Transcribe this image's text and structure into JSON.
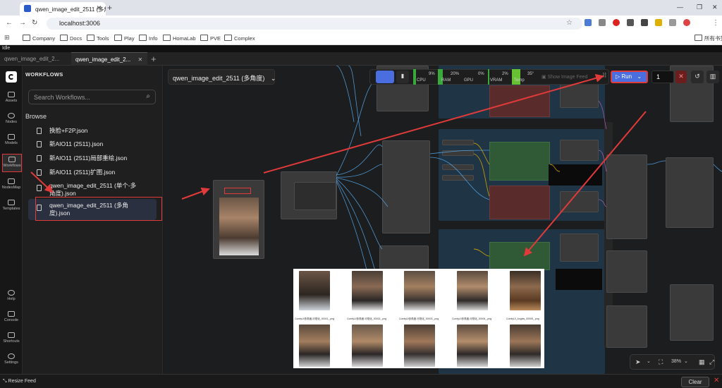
{
  "browser": {
    "tab_title": "qwen_image_edit_2511 (多角",
    "url": "localhost:3006",
    "bookmarks": [
      "Company",
      "Docs",
      "Tools",
      "Play",
      "Info",
      "HomaLab",
      "PVE",
      "Complex"
    ],
    "bookmarks_right": "所有书签"
  },
  "app": {
    "status": "Idle",
    "tabs": [
      {
        "label": "qwen_image_edit_2...",
        "active": false
      },
      {
        "label": "qwen_image_edit_2...",
        "active": true
      }
    ],
    "new_tab_icon": "plus-icon"
  },
  "rail": {
    "top": [
      {
        "label": "Assets",
        "icon": "image-icon"
      },
      {
        "label": "Nodes",
        "icon": "nodes-icon"
      },
      {
        "label": "Models",
        "icon": "cube-icon"
      },
      {
        "label": "Workflows",
        "icon": "workflow-icon",
        "active": true
      },
      {
        "label": "NodesMap",
        "icon": "map-icon"
      },
      {
        "label": "Templates",
        "icon": "template-icon"
      }
    ],
    "bottom": [
      {
        "label": "Help",
        "icon": "help-icon"
      },
      {
        "label": "Console",
        "icon": "console-icon"
      },
      {
        "label": "Shortcuts",
        "icon": "keyboard-icon"
      },
      {
        "label": "Settings",
        "icon": "gear-icon"
      }
    ]
  },
  "sidebar": {
    "title": "WORKFLOWS",
    "search_placeholder": "Search Workflows...",
    "browse_label": "Browse",
    "files": [
      "换脸+F2P.json",
      "新AIO11 (2511).json",
      "新AIO11 (2511)局部重绘.json",
      "新AIO11 (2511)扩图.json",
      "qwen_image_edit_2511 (单个-多角度).json",
      "qwen_image_edit_2511 (多角度).json"
    ],
    "selected_index": 5
  },
  "canvas": {
    "workflow_title": "qwen_image_edit_2511 (多角度)",
    "zoom": "38%"
  },
  "toolbar": {
    "monitors": [
      {
        "label": "CPU",
        "value": "9%",
        "color": "#3aa83a"
      },
      {
        "label": "RAM",
        "value": "20%",
        "color": "#3aa83a"
      },
      {
        "label": "GPU",
        "value": "0%",
        "color": "#3aa83a"
      },
      {
        "label": "VRAM",
        "value": "2%",
        "color": "#3aa83a"
      },
      {
        "label": "Temp",
        "value": "35°",
        "color": "#66c233"
      }
    ],
    "show_image_feed": "Show Image Feed",
    "run_label": "Run",
    "queue_count": "1"
  },
  "preview": {
    "captions": [
      "ComfyUI多角度-可视化_00001_.png",
      "ComfyUI多角度-可视化_00002_.png",
      "ComfyUI多角度-可视化_00003_.png",
      "ComfyUI多角度-可视化_00004_.png",
      "ComfyUI_Angles_00005_.png"
    ]
  },
  "bottom": {
    "resize_feed": "Resize Feed",
    "clear_label": "Clear"
  },
  "colors": {
    "accent": "#4a6ee0",
    "annotation": "#e03a3a",
    "link": "#5ab4ff"
  }
}
